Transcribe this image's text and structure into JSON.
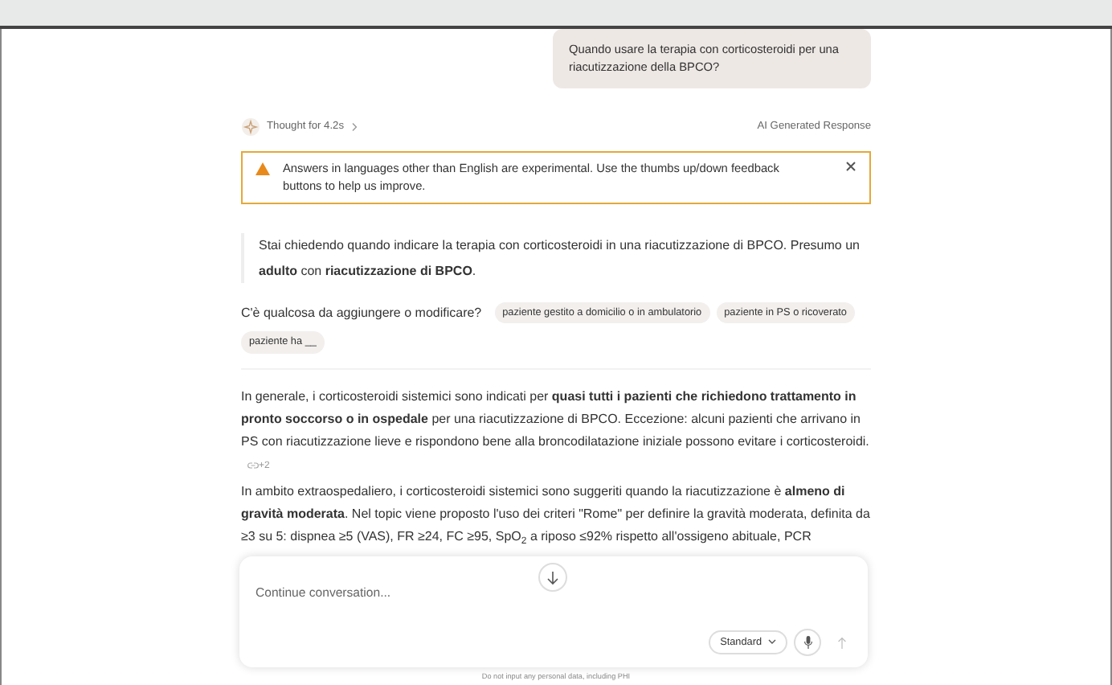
{
  "user_message": "Quando usare la terapia con corticosteroidi per una riacutizzazione della BPCO?",
  "thought": {
    "label": "Thought for 4.2s",
    "expanded": false
  },
  "response_label": "AI Generated Response",
  "alert": {
    "text": "Answers in languages other than English are experimental. Use the thumbs up/down feedback buttons to help us improve."
  },
  "summary": "Stai chiedendo quando indicare la terapia con corticosteroidi in una riacutizzazione di BPCO. Presumo un **adulto** con **riacutizzazione di BPCO**.",
  "followup": {
    "question": "C'è qualcosa da aggiungere o modificare?",
    "chips": [
      "paziente gestito a domicilio o in ambulatorio",
      "paziente in PS o ricoverato",
      "paziente ha __"
    ]
  },
  "answer": [
    {
      "text": "In generale, i corticosteroidi sistemici sono indicati per **quasi tutti i pazienti che richiedono trattamento in pronto soccorso o in ospedale** per una riacutizzazione di BPCO. Eccezione: alcuni pazienti che arrivano in PS con riacutizzazione lieve e rispondono bene alla broncodilatazione iniziale possono evitare i corticosteroidi.",
      "citation": "+2"
    },
    {
      "text": "In ambito extraospedaliero, i corticosteroidi sistemici sono suggeriti quando la riacutizzazione è **almeno di gravità moderata**. Nel topic viene proposto l'uso dei criteri \"Rome\" per definire la gravità moderata, definita da ≥3 su 5: dispnea ≥5 (VAS), FR ≥24, FC ≥95, SpO$_{2}$ a riposo ≤92% rispetto all'ossigeno abituale, PCR"
    }
  ],
  "composer": {
    "placeholder": "Continue conversation...",
    "mode": "Standard"
  },
  "footer": "Do not input any personal data, including PHI"
}
